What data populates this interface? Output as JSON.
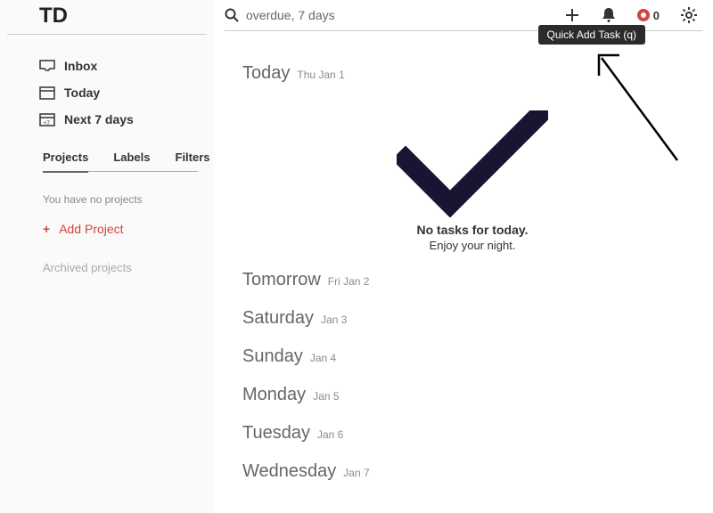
{
  "search": {
    "value": "overdue, 7 days"
  },
  "sidebar": {
    "nav": [
      {
        "label": "Inbox"
      },
      {
        "label": "Today"
      },
      {
        "label": "Next 7 days"
      }
    ],
    "tabs": [
      {
        "label": "Projects",
        "active": true
      },
      {
        "label": "Labels"
      },
      {
        "label": "Filters"
      }
    ],
    "no_projects_text": "You have no projects",
    "add_project_label": "Add Project",
    "archived_label": "Archived projects"
  },
  "topbar": {
    "karma_count": "0",
    "tooltip": "Quick Add Task (q)"
  },
  "days": [
    {
      "name": "Today",
      "date": "Thu Jan 1"
    },
    {
      "name": "Tomorrow",
      "date": "Fri Jan 2"
    },
    {
      "name": "Saturday",
      "date": "Jan 3"
    },
    {
      "name": "Sunday",
      "date": "Jan 4"
    },
    {
      "name": "Monday",
      "date": "Jan 5"
    },
    {
      "name": "Tuesday",
      "date": "Jan 6"
    },
    {
      "name": "Wednesday",
      "date": "Jan 7"
    }
  ],
  "empty": {
    "title": "No tasks for today.",
    "subtitle": "Enjoy your night."
  }
}
